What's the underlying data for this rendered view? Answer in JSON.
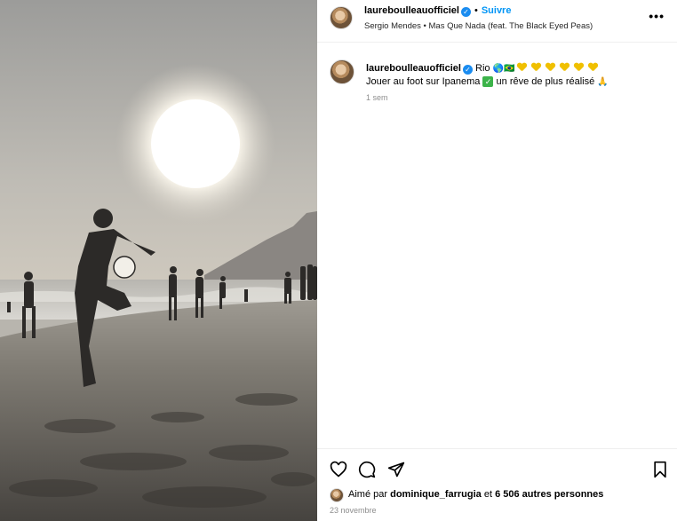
{
  "post": {
    "username": "laureboulleauofficiel",
    "follow_label": "Suivre",
    "separator": "•",
    "song": "Sergio Mendes • Mas Que Nada (feat. The Black Eyed Peas)",
    "more_label": "•••",
    "caption_place": "Rio",
    "caption_text": "Jouer au foot sur Ipanema",
    "caption_text2": "un rêve de plus réalisé",
    "caption_time": "1 sem",
    "liked_prefix": "Aimé par",
    "liked_by": "dominique_farrugia",
    "liked_connector": "et",
    "liked_others": "6 506 autres personnes",
    "date": "23 novembre"
  },
  "colors": {
    "accent": "#0095f6",
    "verified": "#1a8cf0",
    "muted": "#8e8e8e"
  },
  "icons": {
    "like": "heart-icon",
    "comment": "comment-icon",
    "share": "paper-plane-icon",
    "save": "bookmark-icon",
    "more": "more-dots-icon"
  }
}
